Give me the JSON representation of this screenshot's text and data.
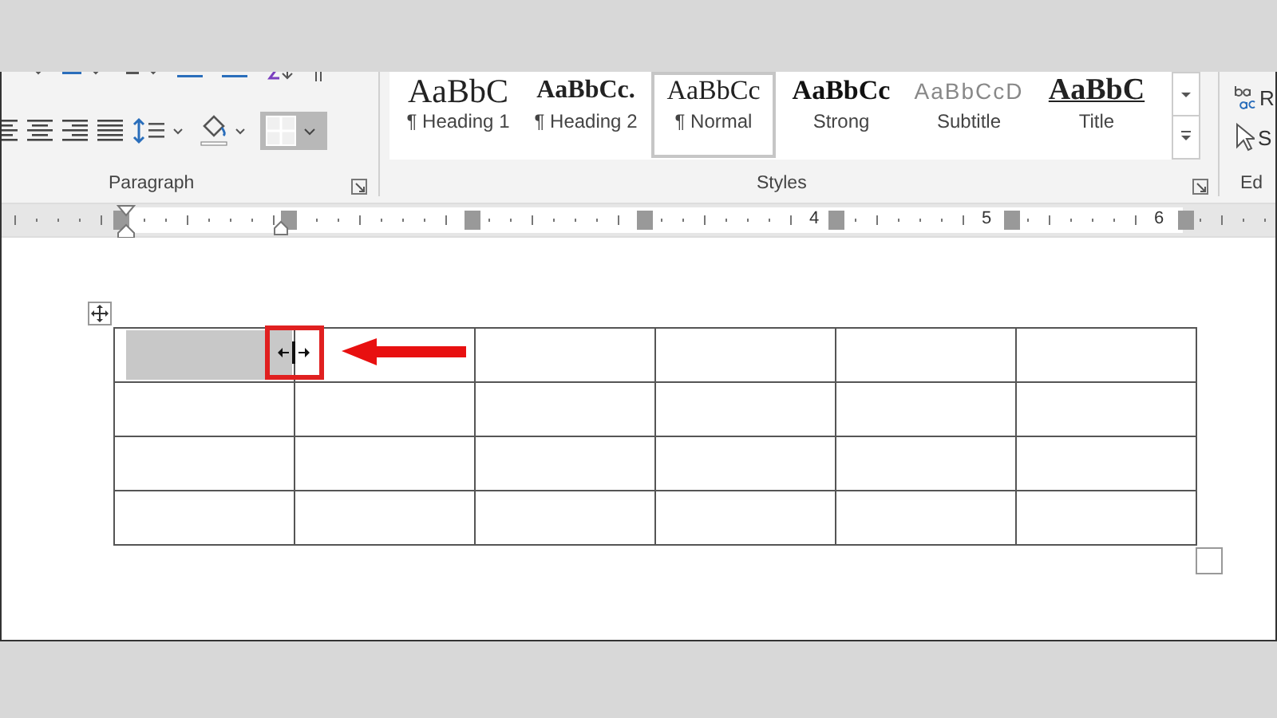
{
  "ribbon": {
    "paragraph_group": {
      "label": "Paragraph"
    },
    "styles_group": {
      "label": "Styles",
      "items": [
        {
          "kind": "heading1",
          "preview": "AaBbC",
          "name": "¶ Heading 1",
          "selected": false
        },
        {
          "kind": "heading2",
          "preview": "AaBbCc.",
          "name": "¶ Heading 2",
          "selected": false
        },
        {
          "kind": "normal",
          "preview": "AaBbCc",
          "name": "¶ Normal",
          "selected": true
        },
        {
          "kind": "strong",
          "preview": "AaBbCc",
          "name": "Strong",
          "selected": false
        },
        {
          "kind": "subtitle",
          "preview": "AaBbCcD",
          "name": "Subtitle",
          "selected": false
        },
        {
          "kind": "title",
          "preview": "AaBbC",
          "name": "Title",
          "selected": false
        }
      ]
    },
    "editing_group": {
      "label": "Ed",
      "replace": "R",
      "select": "S"
    }
  },
  "ruler": {
    "numbers": [
      "4",
      "5",
      "6"
    ]
  },
  "table": {
    "rows": [
      [
        {
          "selected": true
        },
        {
          "selected": false
        },
        {
          "selected": false
        },
        {
          "selected": false
        },
        {
          "selected": false
        },
        {
          "selected": false
        }
      ],
      [
        {
          "selected": false
        },
        {
          "selected": false
        },
        {
          "selected": false
        },
        {
          "selected": false
        },
        {
          "selected": false
        },
        {
          "selected": false
        }
      ],
      [
        {
          "selected": false
        },
        {
          "selected": false
        },
        {
          "selected": false
        },
        {
          "selected": false
        },
        {
          "selected": false
        },
        {
          "selected": false
        }
      ],
      [
        {
          "selected": false
        },
        {
          "selected": false
        },
        {
          "selected": false
        },
        {
          "selected": false
        },
        {
          "selected": false
        },
        {
          "selected": false
        }
      ]
    ]
  }
}
